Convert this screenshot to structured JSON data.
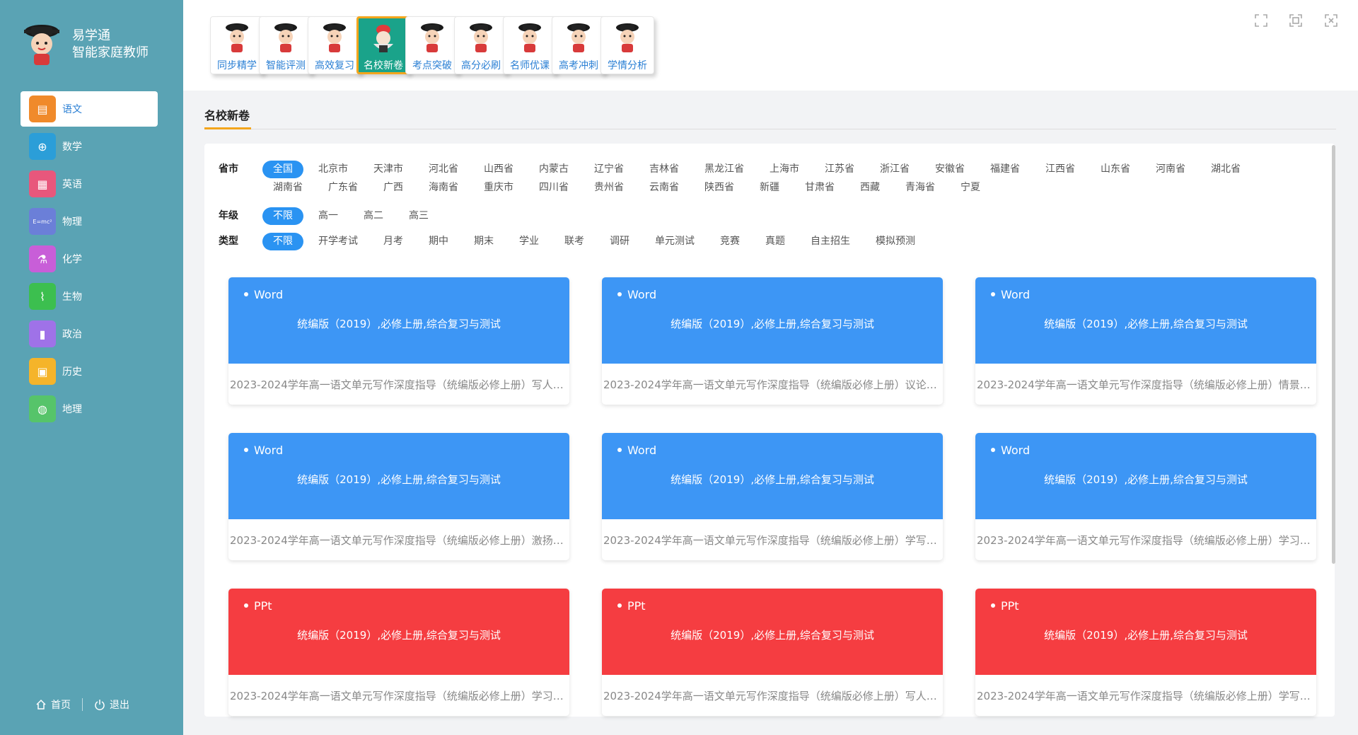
{
  "brand": {
    "line1": "易学通",
    "line2": "智能家庭教师"
  },
  "nav": [
    {
      "label": "语文",
      "icon": "book-icon",
      "glyph": "▤",
      "color": "#f08a2b",
      "active": true
    },
    {
      "label": "数学",
      "icon": "math-symbols-icon",
      "glyph": "⊕",
      "color": "#2b9ed8"
    },
    {
      "label": "英语",
      "icon": "notebook-icon",
      "glyph": "▦",
      "color": "#e8577c"
    },
    {
      "label": "物理",
      "icon": "formula-icon",
      "glyph": "E=mc²",
      "color": "#6b7fd8"
    },
    {
      "label": "化学",
      "icon": "flask-icon",
      "glyph": "⚗",
      "color": "#c85ed8"
    },
    {
      "label": "生物",
      "icon": "dna-icon",
      "glyph": "⌇",
      "color": "#3cbf4f"
    },
    {
      "label": "政治",
      "icon": "bar-chart-icon",
      "glyph": "▮",
      "color": "#9f72e8"
    },
    {
      "label": "历史",
      "icon": "scroll-icon",
      "glyph": "▣",
      "color": "#f5b42a"
    },
    {
      "label": "地理",
      "icon": "globe-icon",
      "glyph": "◍",
      "color": "#56c46a"
    }
  ],
  "footer": {
    "home": "首页",
    "logout": "退出"
  },
  "tools": [
    {
      "label": "同步精学",
      "name": "tool-sync-study"
    },
    {
      "label": "智能评测",
      "name": "tool-smart-assessment"
    },
    {
      "label": "高效复习",
      "name": "tool-efficient-review"
    },
    {
      "label": "名校新卷",
      "name": "tool-elite-school-papers",
      "active": true
    },
    {
      "label": "考点突破",
      "name": "tool-key-points"
    },
    {
      "label": "高分必刷",
      "name": "tool-high-score-drill"
    },
    {
      "label": "名师优课",
      "name": "tool-master-lessons"
    },
    {
      "label": "高考冲刺",
      "name": "tool-gaokao-sprint"
    },
    {
      "label": "学情分析",
      "name": "tool-learning-analysis"
    }
  ],
  "section_title": "名校新卷",
  "filters": [
    {
      "label": "省市",
      "options": [
        "全国",
        "北京市",
        "天津市",
        "河北省",
        "山西省",
        "内蒙古",
        "辽宁省",
        "吉林省",
        "黑龙江省",
        "上海市",
        "江苏省",
        "浙江省",
        "安徽省",
        "福建省",
        "江西省",
        "山东省",
        "河南省",
        "湖北省",
        "湖南省",
        "广东省",
        "广西",
        "海南省",
        "重庆市",
        "四川省",
        "贵州省",
        "云南省",
        "陕西省",
        "新疆",
        "甘肃省",
        "西藏",
        "青海省",
        "宁夏"
      ],
      "selected": 0
    },
    {
      "label": "年级",
      "options": [
        "不限",
        "高一",
        "高二",
        "高三"
      ],
      "selected": 0
    },
    {
      "label": "类型",
      "options": [
        "不限",
        "开学考试",
        "月考",
        "期中",
        "期末",
        "学业",
        "联考",
        "调研",
        "单元测试",
        "竞赛",
        "真题",
        "自主招生",
        "模拟预测"
      ],
      "selected": 0
    }
  ],
  "colors": {
    "word": "#3d96f5",
    "ppt": "#f53d41",
    "accent": "#2a93f2",
    "sidebar": "#5aa3b4"
  },
  "cards": [
    {
      "type": "Word",
      "subtitle": "统编版（2019）,必修上册,综合复习与测试",
      "title": "2023-2024学年高一语文单元写作深度指导（统编版必修上册）写人要..."
    },
    {
      "type": "Word",
      "subtitle": "统编版（2019）,必修上册,综合复习与测试",
      "title": "2023-2024学年高一语文单元写作深度指导（统编版必修上册）议论要..."
    },
    {
      "type": "Word",
      "subtitle": "统编版（2019）,必修上册,综合复习与测试",
      "title": "2023-2024学年高一语文单元写作深度指导（统编版必修上册）情景交..."
    },
    {
      "type": "Word",
      "subtitle": "统编版（2019）,必修上册,综合复习与测试",
      "title": "2023-2024学年高一语文单元写作深度指导（统编版必修上册）激扬青..."
    },
    {
      "type": "Word",
      "subtitle": "统编版（2019）,必修上册,综合复习与测试",
      "title": "2023-2024学年高一语文单元写作深度指导（统编版必修上册）学写文..."
    },
    {
      "type": "Word",
      "subtitle": "统编版（2019）,必修上册,综合复习与测试",
      "title": "2023-2024学年高一语文单元写作深度指导（统编版必修上册）学习之..."
    },
    {
      "type": "PPt",
      "subtitle": "统编版（2019）,必修上册,综合复习与测试",
      "title": "2023-2024学年高一语文单元写作深度指导（统编版必修上册）学习之..."
    },
    {
      "type": "PPt",
      "subtitle": "统编版（2019）,必修上册,综合复习与测试",
      "title": "2023-2024学年高一语文单元写作深度指导（统编版必修上册）写人要..."
    },
    {
      "type": "PPt",
      "subtitle": "统编版（2019）,必修上册,综合复习与测试",
      "title": "2023-2024学年高一语文单元写作深度指导（统编版必修上册）学写文..."
    }
  ]
}
